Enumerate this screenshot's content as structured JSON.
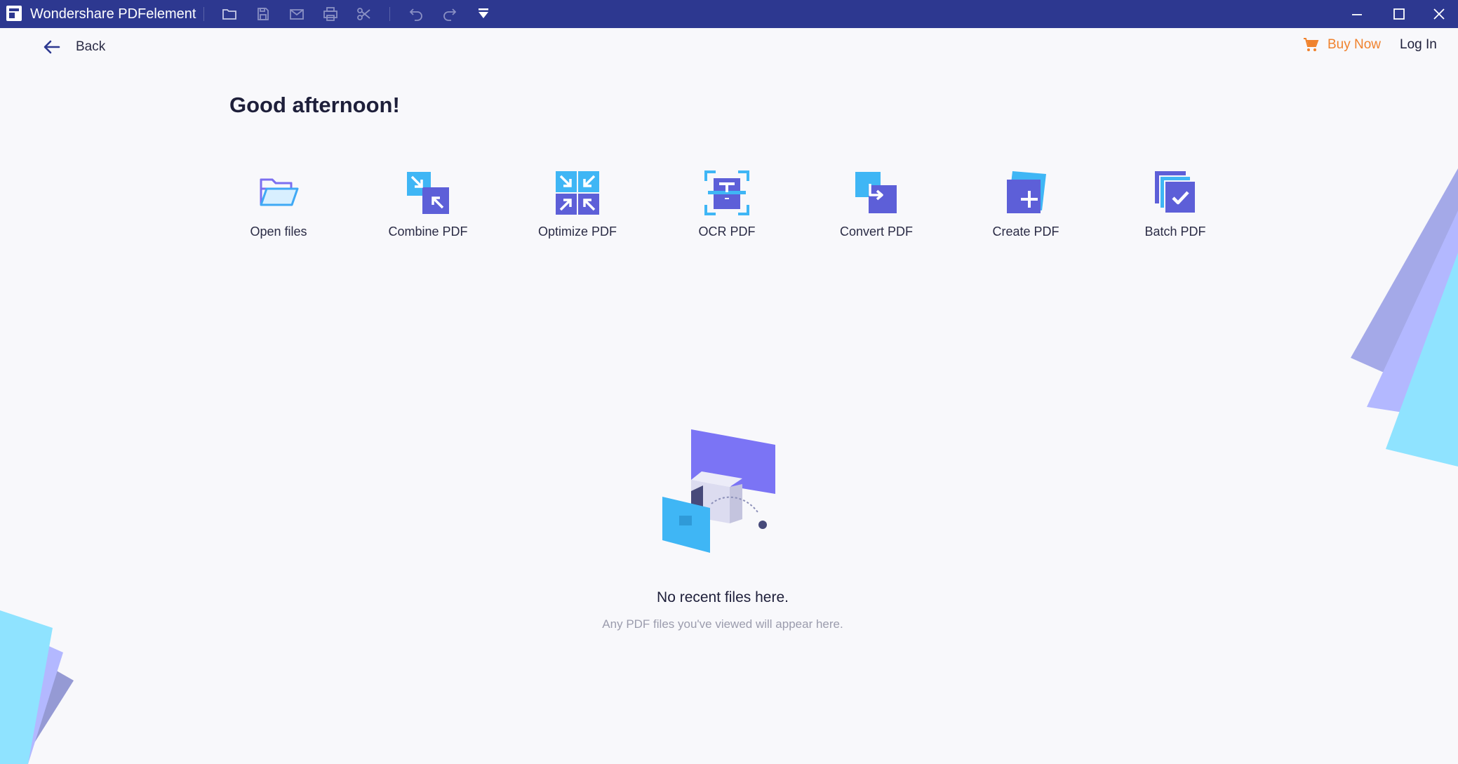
{
  "titlebar": {
    "app_name": "Wondershare PDFelement",
    "background": "#2d3890",
    "tools": [
      {
        "name": "open-folder-icon"
      },
      {
        "name": "save-icon"
      },
      {
        "name": "mail-icon"
      },
      {
        "name": "print-icon"
      },
      {
        "name": "scissors-icon"
      },
      {
        "name": "undo-icon"
      },
      {
        "name": "redo-icon"
      },
      {
        "name": "dropdown-arrow-icon"
      }
    ],
    "window_controls": [
      "minimize-icon",
      "maximize-icon",
      "close-icon"
    ]
  },
  "header": {
    "back_label": "Back",
    "buy_now_label": "Buy Now",
    "login_label": "Log In",
    "accent_orange": "#f0822d"
  },
  "home": {
    "greeting": "Good afternoon!",
    "quick_actions": [
      {
        "label": "Open files",
        "icon": "open-files-icon"
      },
      {
        "label": "Combine PDF",
        "icon": "combine-pdf-icon"
      },
      {
        "label": "Optimize PDF",
        "icon": "optimize-pdf-icon"
      },
      {
        "label": "OCR PDF",
        "icon": "ocr-pdf-icon"
      },
      {
        "label": "Convert PDF",
        "icon": "convert-pdf-icon"
      },
      {
        "label": "Create PDF",
        "icon": "create-pdf-icon"
      },
      {
        "label": "Batch PDF",
        "icon": "batch-pdf-icon"
      }
    ],
    "empty_state": {
      "title": "No recent files here.",
      "subtitle": "Any PDF files you've viewed will appear here."
    }
  }
}
